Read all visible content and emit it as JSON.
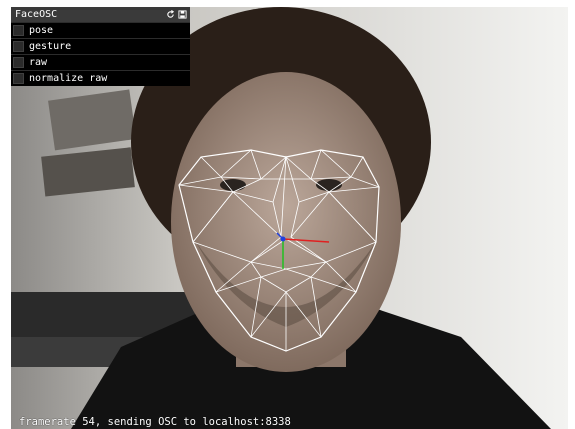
{
  "gui": {
    "title": "FaceOSC",
    "toggles": [
      {
        "label": "pose"
      },
      {
        "label": "gesture"
      },
      {
        "label": "raw"
      },
      {
        "label": "normalize raw"
      }
    ],
    "icons": [
      "refresh-icon",
      "save-icon"
    ]
  },
  "status": {
    "text": "framerate 54, sending OSC to localhost:8338"
  },
  "colors": {
    "panel_bg": "#000000",
    "title_bg": "#3a3a3a",
    "mesh": "#ffffff",
    "axis_x": "#e02020",
    "axis_y": "#20c020",
    "axis_z": "#2040e0"
  }
}
